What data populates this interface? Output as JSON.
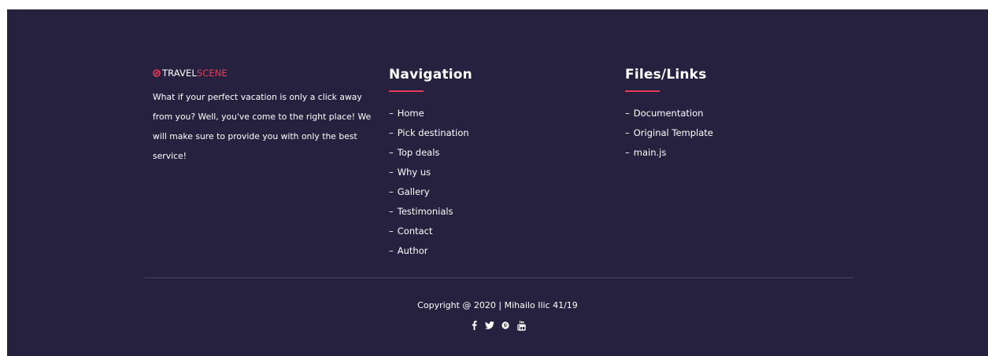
{
  "brand": {
    "part1": "TRAVEL",
    "part2": "SCENE",
    "accent_color": "#e63b57",
    "icon": "location-pin-icon"
  },
  "about": {
    "text": "What if your perfect vacation is only a click away from you? Well, you've come to the right place! We will make sure to provide you with only the best service!"
  },
  "navigation": {
    "title": "Navigation",
    "items": [
      {
        "dash": "–",
        "label": "Home"
      },
      {
        "dash": "–",
        "label": "Pick destination"
      },
      {
        "dash": "–",
        "label": "Top deals"
      },
      {
        "dash": "–",
        "label": "Why us"
      },
      {
        "dash": "–",
        "label": "Gallery"
      },
      {
        "dash": "–",
        "label": "Testimonials"
      },
      {
        "dash": "–",
        "label": "Contact"
      },
      {
        "dash": "–",
        "label": "Author"
      }
    ]
  },
  "files": {
    "title": "Files/Links",
    "items": [
      {
        "dash": "–",
        "label": "Documentation"
      },
      {
        "dash": "–",
        "label": "Original Template"
      },
      {
        "dash": "–",
        "label": "main.js"
      }
    ]
  },
  "footer": {
    "copyright": "Copyright @ 2020 | Mihailo Ilic 41/19",
    "background": "#25213f",
    "social": [
      "facebook-icon",
      "twitter-icon",
      "pinterest-icon",
      "youtube-icon"
    ]
  }
}
